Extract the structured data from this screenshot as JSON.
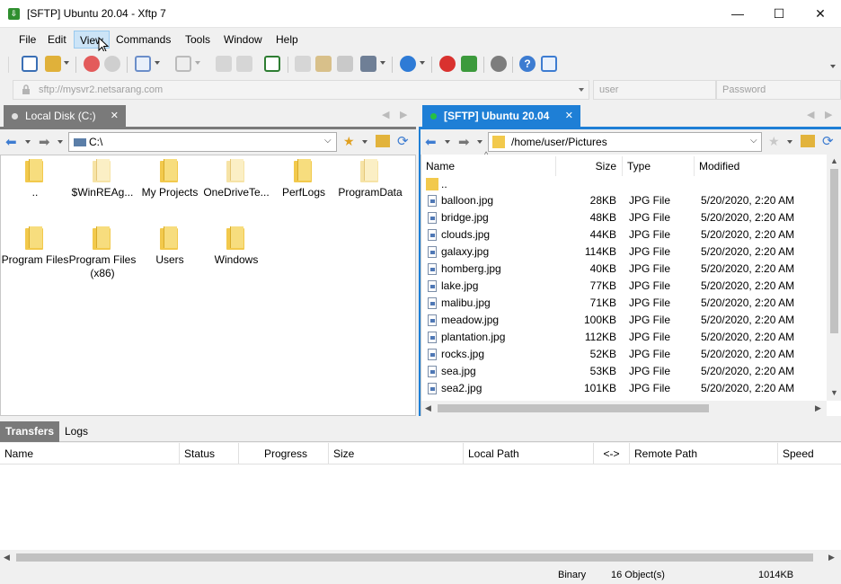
{
  "window": {
    "title": "[SFTP] Ubuntu 20.04 - Xftp 7",
    "minimize": "—",
    "maximize": "☐",
    "close": "✕"
  },
  "menu": [
    "File",
    "Edit",
    "View",
    "Commands",
    "Tools",
    "Window",
    "Help"
  ],
  "address": {
    "host": "sftp://mysvr2.netsarang.com",
    "user_placeholder": "user",
    "password_placeholder": "Password"
  },
  "local": {
    "tab_label": "Local Disk (C:)",
    "path": "C:\\",
    "folders": [
      {
        "name": "..",
        "light": false
      },
      {
        "name": "$WinREAg...",
        "light": true
      },
      {
        "name": "My Projects",
        "light": false
      },
      {
        "name": "OneDriveTe...",
        "light": true
      },
      {
        "name": "PerfLogs",
        "light": false
      },
      {
        "name": "ProgramData",
        "light": true
      },
      {
        "name": "Program Files",
        "light": false
      },
      {
        "name": "Program Files (x86)",
        "light": false
      },
      {
        "name": "Users",
        "light": false
      },
      {
        "name": "Windows",
        "light": false
      }
    ]
  },
  "remote": {
    "tab_label": "[SFTP] Ubuntu 20.04",
    "path": "/home/user/Pictures",
    "columns": {
      "name": "Name",
      "size": "Size",
      "type": "Type",
      "modified": "Modified"
    },
    "updir": "..",
    "files": [
      {
        "name": "balloon.jpg",
        "size": "28KB",
        "type": "JPG File",
        "modified": "5/20/2020, 2:20 AM"
      },
      {
        "name": "bridge.jpg",
        "size": "48KB",
        "type": "JPG File",
        "modified": "5/20/2020, 2:20 AM"
      },
      {
        "name": "clouds.jpg",
        "size": "44KB",
        "type": "JPG File",
        "modified": "5/20/2020, 2:20 AM"
      },
      {
        "name": "galaxy.jpg",
        "size": "114KB",
        "type": "JPG File",
        "modified": "5/20/2020, 2:20 AM"
      },
      {
        "name": "homberg.jpg",
        "size": "40KB",
        "type": "JPG File",
        "modified": "5/20/2020, 2:20 AM"
      },
      {
        "name": "lake.jpg",
        "size": "77KB",
        "type": "JPG File",
        "modified": "5/20/2020, 2:20 AM"
      },
      {
        "name": "malibu.jpg",
        "size": "71KB",
        "type": "JPG File",
        "modified": "5/20/2020, 2:20 AM"
      },
      {
        "name": "meadow.jpg",
        "size": "100KB",
        "type": "JPG File",
        "modified": "5/20/2020, 2:20 AM"
      },
      {
        "name": "plantation.jpg",
        "size": "112KB",
        "type": "JPG File",
        "modified": "5/20/2020, 2:20 AM"
      },
      {
        "name": "rocks.jpg",
        "size": "52KB",
        "type": "JPG File",
        "modified": "5/20/2020, 2:20 AM"
      },
      {
        "name": "sea.jpg",
        "size": "53KB",
        "type": "JPG File",
        "modified": "5/20/2020, 2:20 AM"
      },
      {
        "name": "sea2.jpg",
        "size": "101KB",
        "type": "JPG File",
        "modified": "5/20/2020, 2:20 AM"
      }
    ]
  },
  "transfers": {
    "tabs": [
      "Transfers",
      "Logs"
    ],
    "columns": [
      "Name",
      "Status",
      "Progress",
      "Size",
      "Local Path",
      "<->",
      "Remote Path",
      "Speed"
    ]
  },
  "status": {
    "mode": "Binary",
    "objects": "16 Object(s)",
    "total": "1014KB"
  },
  "colors": {
    "accent": "#1e7fd6",
    "folder": "#f2c94c"
  }
}
